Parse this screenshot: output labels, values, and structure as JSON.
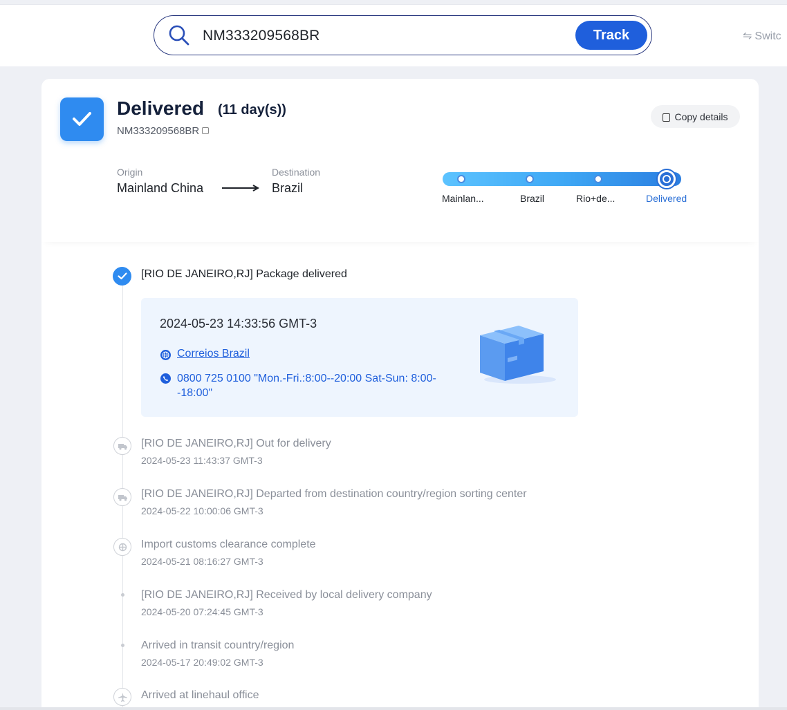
{
  "search": {
    "value": "NM333209568BR",
    "track_label": "Track",
    "switch_label": "Switc"
  },
  "summary": {
    "status": "Delivered",
    "days": "(11 day(s))",
    "tracking_number": "NM333209568BR",
    "copy_label": "Copy details",
    "origin_label": "Origin",
    "origin_value": "Mainland China",
    "destination_label": "Destination",
    "destination_value": "Brazil"
  },
  "progress": {
    "steps": [
      "Mainlan...",
      "Brazil",
      "Rio+de...",
      "Delivered"
    ],
    "current_index": 3
  },
  "timeline": {
    "latest": {
      "title": "[RIO DE JANEIRO,RJ] Package delivered",
      "time": "2024-05-23 14:33:56 GMT-3",
      "carrier": "Correios Brazil",
      "phone": "0800 725 0100 \"Mon.-Fri.:8:00--20:00 Sat-Sun: 8:00--18:00\""
    },
    "events": [
      {
        "title": "[RIO DE JANEIRO,RJ] Out for delivery",
        "time": "2024-05-23 11:43:37 GMT-3",
        "icon": "truck-icon"
      },
      {
        "title": "[RIO DE JANEIRO,RJ] Departed from destination country/region sorting center",
        "time": "2024-05-22 10:00:06 GMT-3",
        "icon": "truck-icon"
      },
      {
        "title": "Import customs clearance complete",
        "time": "2024-05-21 08:16:27 GMT-3",
        "icon": "customs-icon"
      },
      {
        "title": "[RIO DE JANEIRO,RJ] Received by local delivery company",
        "time": "2024-05-20 07:24:45 GMT-3",
        "icon": "dot"
      },
      {
        "title": "Arrived in transit country/region",
        "time": "2024-05-17 20:49:02 GMT-3",
        "icon": "dot"
      },
      {
        "title": "Arrived at linehaul office",
        "time": "",
        "icon": "plane-icon"
      }
    ]
  },
  "colors": {
    "accent": "#1f5fdc",
    "badge": "#2f8bf0",
    "muted": "#8a8f99"
  }
}
